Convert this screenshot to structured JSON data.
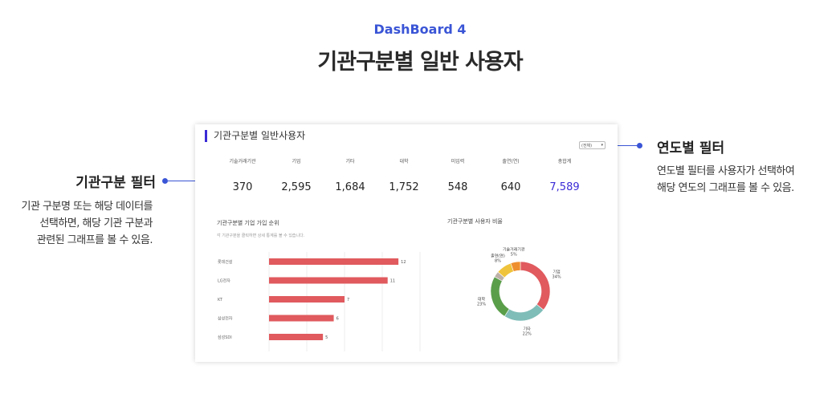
{
  "header": {
    "subtitle": "DashBoard 4",
    "title": "기관구분별 일반 사용자"
  },
  "left_callout": {
    "title": "기관구분 필터",
    "desc": "기관 구분명 또는 해당 데이터를\n선택하면, 해당 기관 구분과\n관련된 그래프를 볼 수 있음."
  },
  "right_callout": {
    "title": "연도별 필터",
    "desc": "연도별 필터를 사용자가 선택하여\n해당 연도의 그래프를 볼 수 있음."
  },
  "card": {
    "title": "기관구분별 일반사용자",
    "year_filter": {
      "value": "(전체)",
      "arrow": "▾"
    },
    "stats": [
      {
        "label": "기술거래기관",
        "value": "370"
      },
      {
        "label": "기업",
        "value": "2,595"
      },
      {
        "label": "기타",
        "value": "1,684"
      },
      {
        "label": "대학",
        "value": "1,752"
      },
      {
        "label": "미입력",
        "value": "548"
      },
      {
        "label": "출연(연)",
        "value": "640"
      },
      {
        "label": "총합계",
        "value": "7,589"
      }
    ],
    "bar_section": {
      "title": "기관구분별 기업 가입 순위",
      "desc": "각 기관구분을 클릭하면 상세 통계를 볼 수 있습니다."
    },
    "donut_section": {
      "title": "기관구분별 사용자 비율"
    }
  },
  "colors": {
    "accent": "#3a55d6",
    "total": "#3a2ad6",
    "bar": "#e05a5e"
  },
  "chart_data": [
    {
      "type": "bar",
      "orientation": "horizontal",
      "title": "기관구분별 기업 가입 순위",
      "categories": [
        "롯데건설",
        "LG전자",
        "KT",
        "삼성전자",
        "삼성SDI"
      ],
      "values": [
        12,
        11,
        7,
        6,
        5
      ],
      "xlim": [
        0,
        14
      ],
      "grid": true
    },
    {
      "type": "pie",
      "donut": true,
      "title": "기관구분별 사용자 비율",
      "slices": [
        {
          "label": "기업",
          "pct": "34%",
          "value": 34,
          "color": "#e05a5e"
        },
        {
          "label": "기타",
          "pct": "22%",
          "value": 22,
          "color": "#7fbdb8"
        },
        {
          "label": "대학",
          "pct": "23%",
          "value": 23,
          "color": "#5a9e4a"
        },
        {
          "label": "",
          "pct": "",
          "value": 3,
          "color": "#bdb1a8"
        },
        {
          "label": "출연(연)",
          "pct": "8%",
          "value": 8,
          "color": "#efc33b"
        },
        {
          "label": "기술거래기관",
          "pct": "5%",
          "value": 5,
          "color": "#ee8f2f"
        }
      ]
    }
  ]
}
